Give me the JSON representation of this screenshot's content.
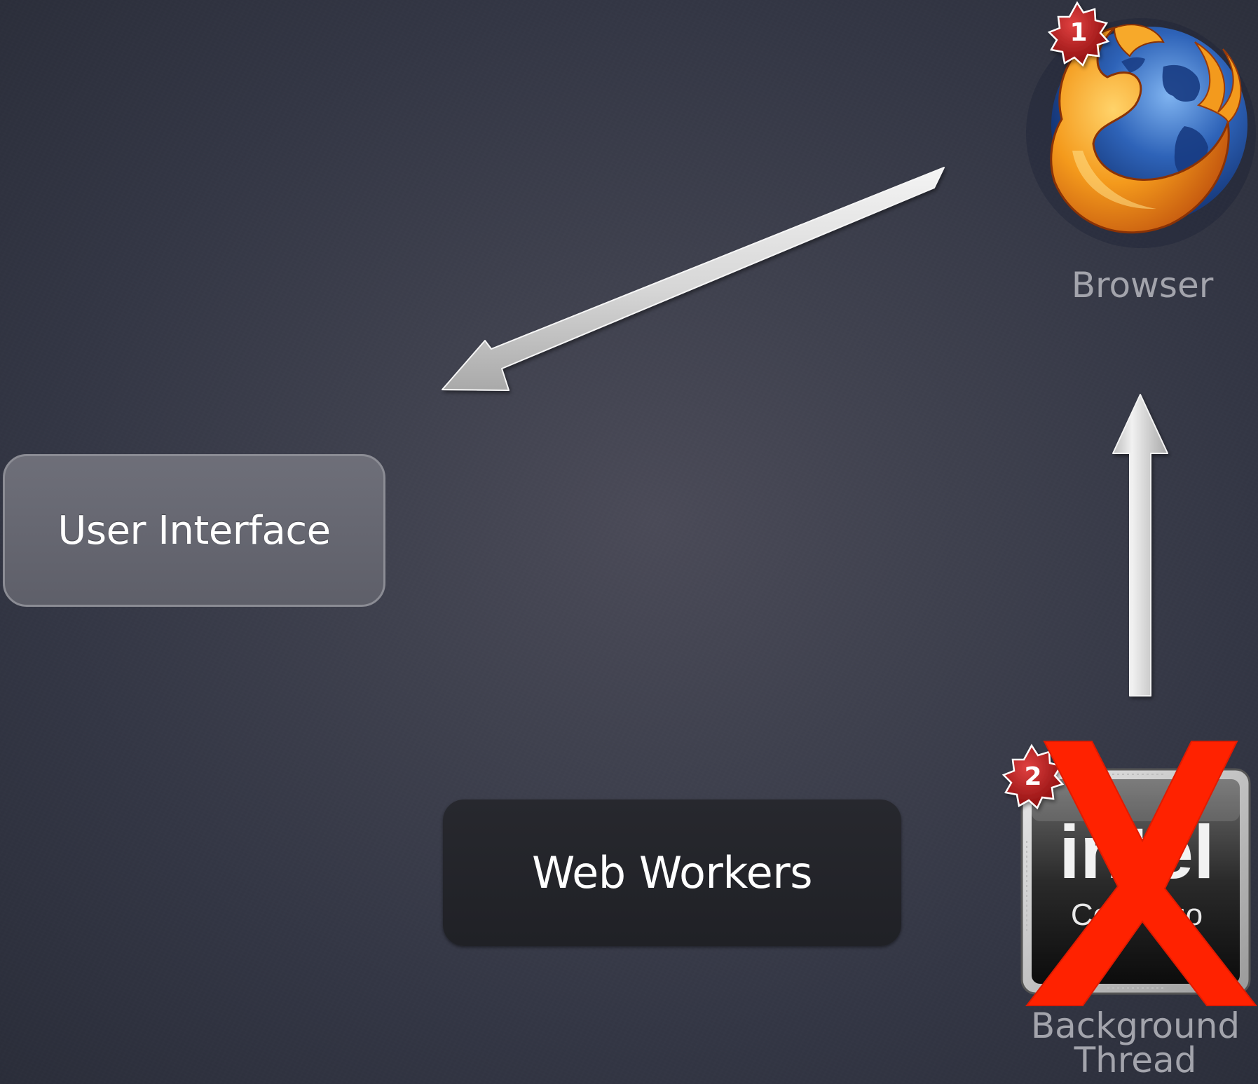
{
  "nodes": {
    "user_interface": "User Interface",
    "web_workers": "Web Workers",
    "browser": "Browser",
    "background_thread": "Background Thread"
  },
  "badges": {
    "browser": "1",
    "background_thread": "2"
  },
  "chip": {
    "brand": "intel",
    "product": "Core Duo"
  },
  "colors": {
    "background": "#3c3e4b",
    "ui_box_fill": "#65666f",
    "web_workers_fill": "#232429",
    "label_gray": "#a3a4ac",
    "arrow_fill": "#d8d8d8",
    "badge_red": "#b01818",
    "cross_red": "#ff2200"
  },
  "icons": {
    "browser": "firefox-logo-icon",
    "background_thread": "intel-core-duo-chip-icon",
    "disabled": "red-x-cross-icon"
  },
  "edges": [
    {
      "from": "browser",
      "to": "user_interface"
    },
    {
      "from": "background_thread",
      "to": "browser"
    }
  ]
}
